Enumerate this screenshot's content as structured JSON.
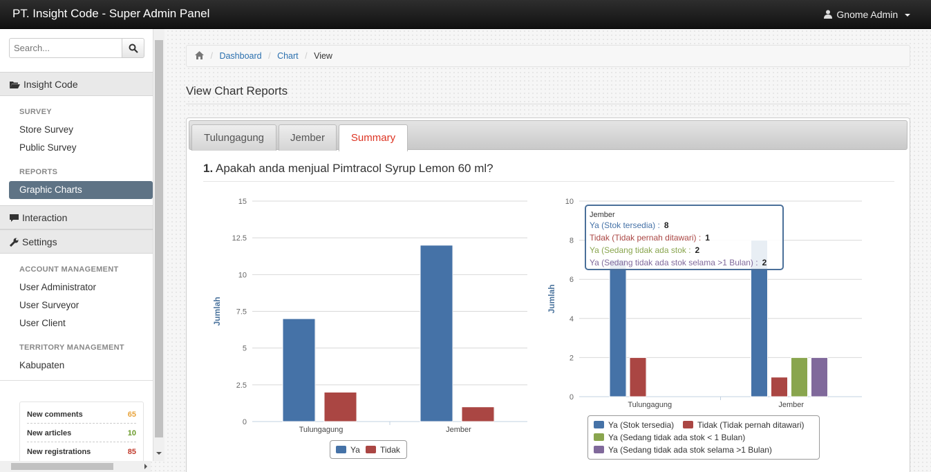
{
  "app": {
    "title": "PT. Insight Code - Super Admin Panel",
    "user": "Gnome Admin"
  },
  "sidebar": {
    "search_placeholder": "Search...",
    "sections": {
      "insight": "Insight Code",
      "interaction": "Interaction",
      "settings": "Settings"
    },
    "survey_label": "SURVEY",
    "survey_items": [
      "Store Survey",
      "Public Survey"
    ],
    "reports_label": "REPORTS",
    "reports_active": "Graphic Charts",
    "account_label": "ACCOUNT MANAGEMENT",
    "account_items": [
      "User Administrator",
      "User Surveyor",
      "User Client"
    ],
    "territory_label": "TERRITORY MANAGEMENT",
    "territory_items": [
      "Kabupaten"
    ],
    "stats": [
      {
        "label": "New comments",
        "value": "65",
        "color": "#e8a33b"
      },
      {
        "label": "New articles",
        "value": "10",
        "color": "#6a9a2a"
      },
      {
        "label": "New registrations",
        "value": "85",
        "color": "#c0392b"
      }
    ]
  },
  "breadcrumb": {
    "dashboard": "Dashboard",
    "chart": "Chart",
    "current": "View"
  },
  "page": {
    "title": "View Chart Reports"
  },
  "tabs": [
    "Tulungagung",
    "Jember",
    "Summary"
  ],
  "question": {
    "number": "1.",
    "text": "Apakah anda menjual Pimtracol Syrup Lemon 60 ml?"
  },
  "tooltip": {
    "title": "Jember",
    "rows": [
      {
        "label": "Ya (Stok tersedia) :",
        "value": "8",
        "color": "#4572a7"
      },
      {
        "label": "Tidak (Tidak pernah ditawari) :",
        "value": "1",
        "color": "#aa4643"
      },
      {
        "label": "Ya (Sedang tidak ada stok  :",
        "value": "2",
        "color": "#89a54e"
      },
      {
        "label": "Ya (Sedang tidak ada stok selama >1 Bulan) :",
        "value": "2",
        "color": "#80699b"
      }
    ]
  },
  "chart_data": [
    {
      "type": "bar",
      "categories": [
        "Tulungagung",
        "Jember"
      ],
      "series": [
        {
          "name": "Ya",
          "values": [
            7,
            12
          ],
          "color": "#4572a7"
        },
        {
          "name": "Tidak",
          "values": [
            2,
            1
          ],
          "color": "#aa4643"
        }
      ],
      "ylabel": "Jumlah",
      "ylim": [
        0,
        15
      ],
      "yticks": [
        "0",
        "2.5",
        "5",
        "7.5",
        "10",
        "12.5",
        "15"
      ],
      "legend": "bottom-center"
    },
    {
      "type": "bar",
      "categories": [
        "Tulungagung",
        "Jember"
      ],
      "series": [
        {
          "name": "Ya (Stok tersedia)",
          "values": [
            7,
            8
          ],
          "color": "#4572a7"
        },
        {
          "name": "Tidak (Tidak pernah ditawari)",
          "values": [
            2,
            1
          ],
          "color": "#aa4643"
        },
        {
          "name": "Ya (Sedang tidak ada stok < 1 Bulan)",
          "values": [
            0,
            2
          ],
          "color": "#89a54e"
        },
        {
          "name": "Ya (Sedang tidak ada stok selama >1 Bulan)",
          "values": [
            0,
            2
          ],
          "color": "#80699b"
        }
      ],
      "ylabel": "Jumlah",
      "ylim": [
        0,
        10
      ],
      "yticks": [
        "0",
        "2",
        "4",
        "6",
        "8",
        "10"
      ],
      "legend": "bottom-center"
    }
  ]
}
